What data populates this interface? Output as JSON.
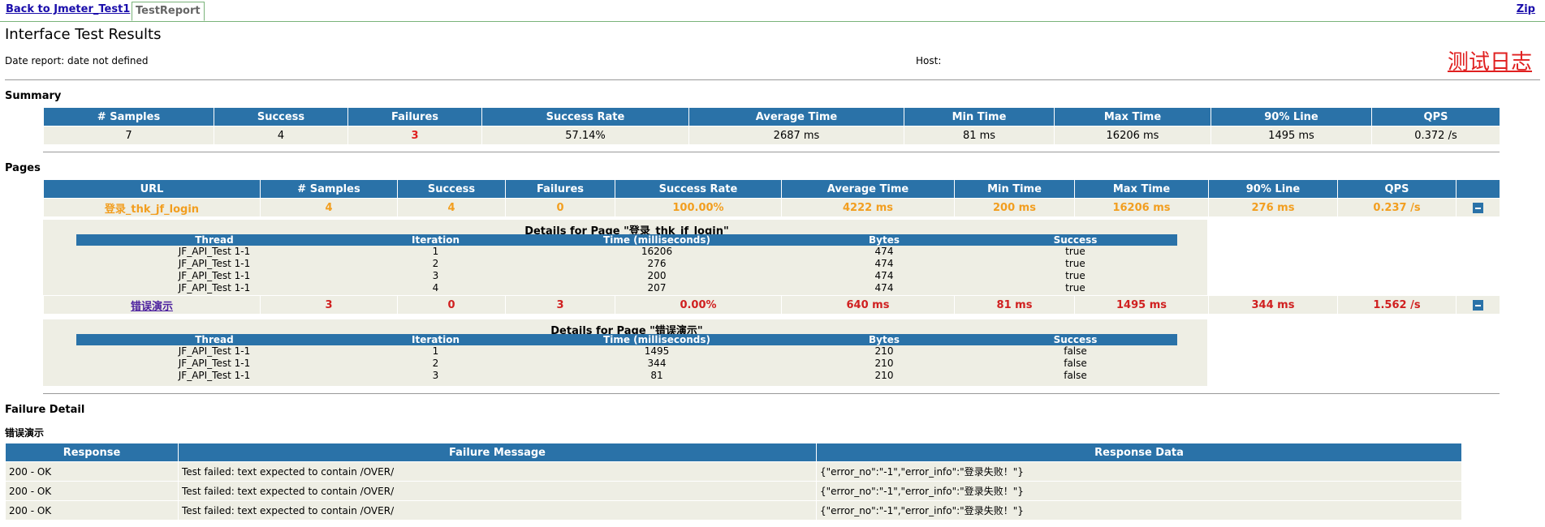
{
  "nav": {
    "back": "Back to Jmeter_Test1",
    "tab": "TestReport",
    "zip": "Zip"
  },
  "header": {
    "title": "Interface Test Results",
    "date": "Date report: date not defined",
    "host": "Host:",
    "log_link": "测试日志"
  },
  "summary": {
    "heading": "Summary",
    "columns": [
      "# Samples",
      "Success",
      "Failures",
      "Success Rate",
      "Average Time",
      "Min Time",
      "Max Time",
      "90% Line",
      "QPS"
    ],
    "row": [
      "7",
      "4",
      "3",
      "57.14%",
      "2687 ms",
      "81 ms",
      "16206 ms",
      "1495 ms",
      "0.372 /s"
    ]
  },
  "pages": {
    "heading": "Pages",
    "columns": [
      "URL",
      "# Samples",
      "Success",
      "Failures",
      "Success Rate",
      "Average Time",
      "Min Time",
      "Max Time",
      "90% Line",
      "QPS"
    ],
    "rows": [
      {
        "cells": [
          "登录_thk_jf_login",
          "4",
          "4",
          "0",
          "100.00%",
          "4222 ms",
          "200 ms",
          "16206 ms",
          "276 ms",
          "0.237 /s"
        ],
        "detail_title": "Details for Page \"登录_thk_jf_login\"",
        "detail_columns": [
          "Thread",
          "Iteration",
          "Time (milliseconds)",
          "Bytes",
          "Success"
        ],
        "detail_rows": [
          [
            "JF_API_Test 1-1",
            "1",
            "16206",
            "474",
            "true"
          ],
          [
            "JF_API_Test 1-1",
            "2",
            "276",
            "474",
            "true"
          ],
          [
            "JF_API_Test 1-1",
            "3",
            "200",
            "474",
            "true"
          ],
          [
            "JF_API_Test 1-1",
            "4",
            "207",
            "474",
            "true"
          ]
        ]
      },
      {
        "cells": [
          "错误演示",
          "3",
          "0",
          "3",
          "0.00%",
          "640 ms",
          "81 ms",
          "1495 ms",
          "344 ms",
          "1.562 /s"
        ],
        "detail_title": "Details for Page \"错误演示\"",
        "detail_columns": [
          "Thread",
          "Iteration",
          "Time (milliseconds)",
          "Bytes",
          "Success"
        ],
        "detail_rows": [
          [
            "JF_API_Test 1-1",
            "1",
            "1495",
            "210",
            "false"
          ],
          [
            "JF_API_Test 1-1",
            "2",
            "344",
            "210",
            "false"
          ],
          [
            "JF_API_Test 1-1",
            "3",
            "81",
            "210",
            "false"
          ]
        ]
      }
    ]
  },
  "failure": {
    "heading": "Failure Detail",
    "subheading": "错误演示",
    "columns": [
      "Response",
      "Failure Message",
      "Response Data"
    ],
    "rows": [
      [
        "200 - OK",
        "Test failed: text expected to contain /OVER/",
        "{\"error_no\":\"-1\",\"error_info\":\"登录失败！\"}"
      ],
      [
        "200 - OK",
        "Test failed: text expected to contain /OVER/",
        "{\"error_no\":\"-1\",\"error_info\":\"登录失败！\"}"
      ],
      [
        "200 - OK",
        "Test failed: text expected to contain /OVER/",
        "{\"error_no\":\"-1\",\"error_info\":\"登录失败！\"}"
      ]
    ]
  }
}
